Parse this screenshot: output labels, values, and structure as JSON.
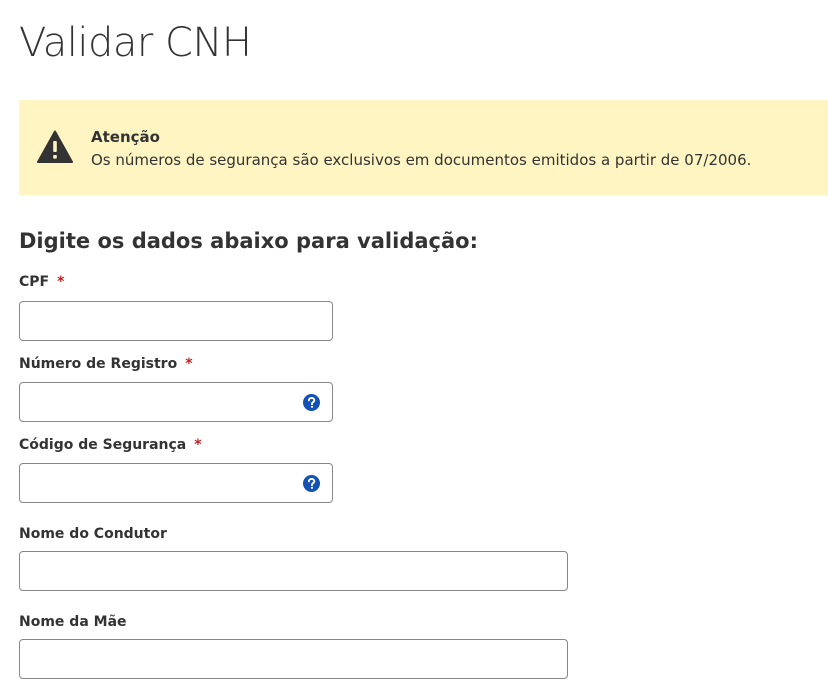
{
  "page": {
    "title": "Validar CNH",
    "subtitle": "Digite os dados abaixo para validação:"
  },
  "alert": {
    "icon": "warning-icon",
    "title": "Atenção",
    "message": "Os números de segurança são exclusivos em documentos emitidos a partir de 07/2006.",
    "background_color": "#fff5c2"
  },
  "form": {
    "required_marker": "*",
    "cpf": {
      "label": "CPF",
      "value": "",
      "placeholder": ""
    },
    "registro": {
      "label": "Número de Registro",
      "value": "",
      "placeholder": "",
      "help_icon": "question-circle-icon"
    },
    "codigo": {
      "label": "Código de Segurança",
      "value": "",
      "placeholder": "",
      "help_icon": "question-circle-icon"
    },
    "condutor": {
      "label": "Nome do Condutor",
      "value": "",
      "placeholder": ""
    },
    "mae": {
      "label": "Nome da Mãe",
      "value": "",
      "placeholder": ""
    }
  },
  "colors": {
    "required": "#c21f1f",
    "help_icon": "#1351b4"
  }
}
